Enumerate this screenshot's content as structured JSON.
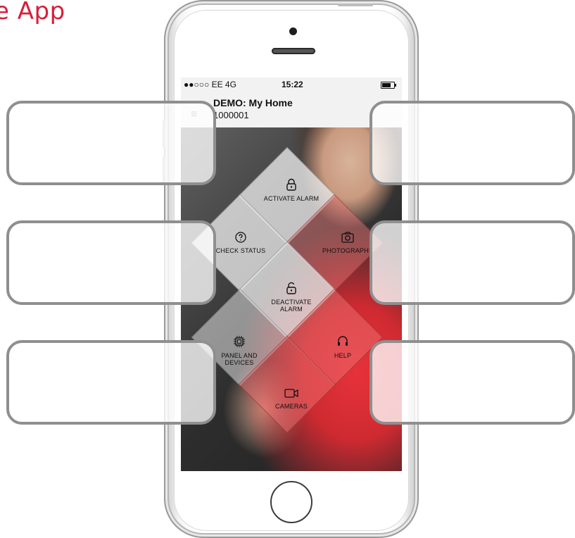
{
  "page": {
    "title_fragment": "e App"
  },
  "status_bar": {
    "signal": "●●○○○ EE  4G",
    "time": "15:22"
  },
  "header": {
    "site_name": "DEMO: My Home",
    "site_id": "1000001"
  },
  "menu": {
    "activate_alarm": "ACTIVATE ALARM",
    "check_status": "CHECK STATUS",
    "photographs": "PHOTOGRAPHS",
    "deactivate_alarm_line1": "DEACTIVATE",
    "deactivate_alarm_line2": "ALARM",
    "panel_devices_line1": "PANEL AND",
    "panel_devices_line2": "DEVICES",
    "help": "HELP",
    "cameras": "CAMERAS"
  },
  "icons": {
    "activate_alarm": "lock-closed-icon",
    "check_status": "question-icon",
    "photographs": "camera-icon",
    "deactivate_alarm": "lock-open-icon",
    "panel_devices": "chip-icon",
    "help": "headset-icon",
    "cameras": "video-camera-icon",
    "menu": "hamburger-icon"
  },
  "colors": {
    "brand_red": "#d6203a",
    "callout_border": "#8f8f8f"
  }
}
